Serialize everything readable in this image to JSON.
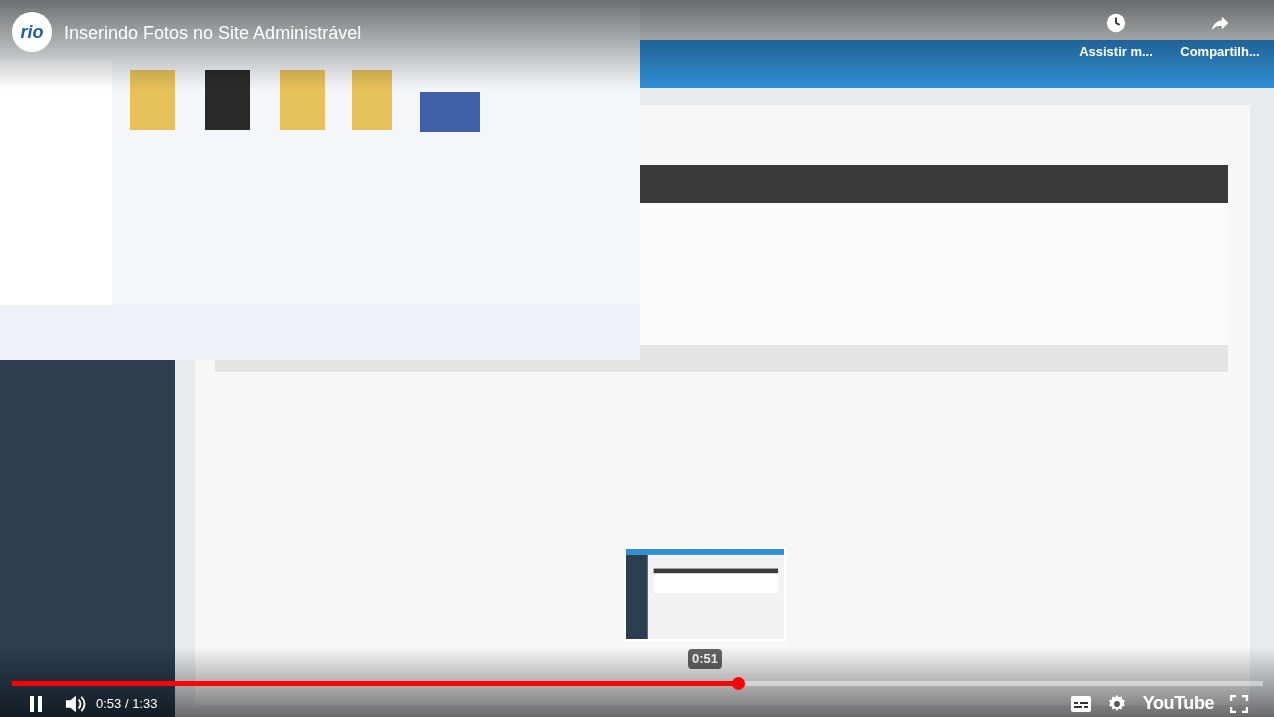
{
  "top_bar": {
    "channel_logo": "rio",
    "title": "Inserindo Fotos no Site Administrável",
    "actions": [
      {
        "kind": "watch_later",
        "label": "Assistir m..."
      },
      {
        "kind": "share",
        "label": "Compartilh..."
      }
    ]
  },
  "preview": {
    "time": "0:51"
  },
  "progress": {
    "level": 0.58
  },
  "controls": {
    "playing": true,
    "time": "0:53 / 1:33",
    "logo": "YouTube"
  }
}
